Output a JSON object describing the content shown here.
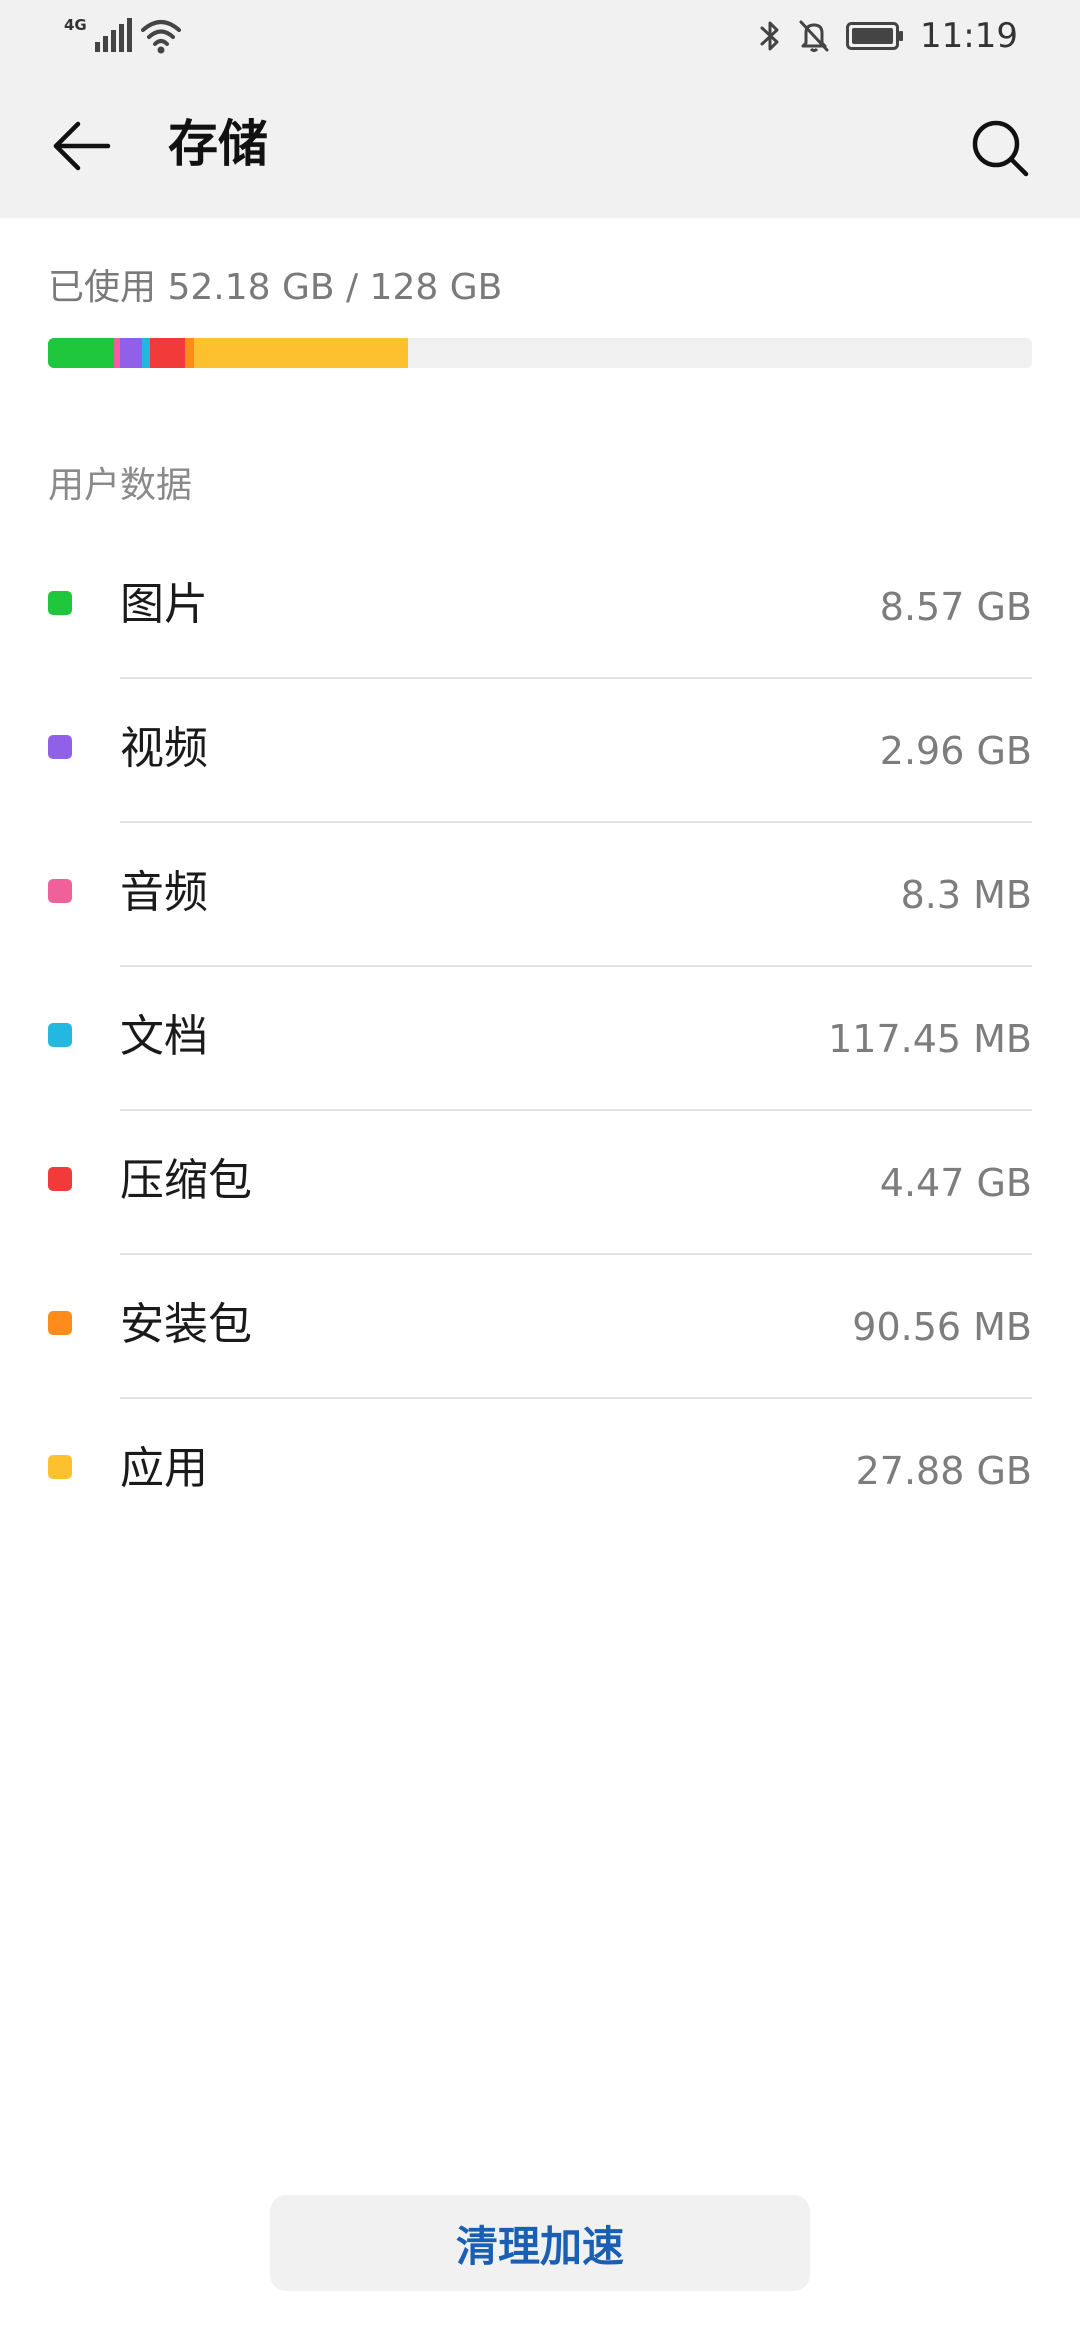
{
  "status_bar": {
    "network_type": "4G",
    "time": "11:19"
  },
  "app_bar": {
    "title": "存储"
  },
  "usage": {
    "text": "已使用 52.18 GB / 128 GB",
    "segments": [
      {
        "name": "图片",
        "fraction": 0.067,
        "color": "#1ec63c"
      },
      {
        "name": "音频",
        "fraction": 0.006,
        "color": "#f0609a"
      },
      {
        "name": "视频",
        "fraction": 0.023,
        "color": "#9060e8"
      },
      {
        "name": "文档",
        "fraction": 0.008,
        "color": "#22b8e0"
      },
      {
        "name": "压缩包",
        "fraction": 0.035,
        "color": "#f23a3a"
      },
      {
        "name": "安装包",
        "fraction": 0.009,
        "color": "#ff8c1a"
      },
      {
        "name": "应用",
        "fraction": 0.218,
        "color": "#fdc02f"
      }
    ]
  },
  "section": {
    "label": "用户数据"
  },
  "items": [
    {
      "label": "图片",
      "value": "8.57 GB",
      "color": "#1ec63c"
    },
    {
      "label": "视频",
      "value": "2.96 GB",
      "color": "#9060e8"
    },
    {
      "label": "音频",
      "value": "8.3 MB",
      "color": "#f0609a"
    },
    {
      "label": "文档",
      "value": "117.45 MB",
      "color": "#22b8e0"
    },
    {
      "label": "压缩包",
      "value": "4.47 GB",
      "color": "#f23a3a"
    },
    {
      "label": "安装包",
      "value": "90.56 MB",
      "color": "#ff8c1a"
    },
    {
      "label": "应用",
      "value": "27.88 GB",
      "color": "#fdc02f"
    }
  ],
  "footer": {
    "clean_label": "清理加速"
  },
  "icons": {
    "back": "arrow-left-icon",
    "search": "search-icon",
    "bluetooth": "bluetooth-icon",
    "mute": "bell-off-icon",
    "battery": "battery-icon",
    "signal": "signal-icon",
    "wifi": "wifi-icon"
  }
}
